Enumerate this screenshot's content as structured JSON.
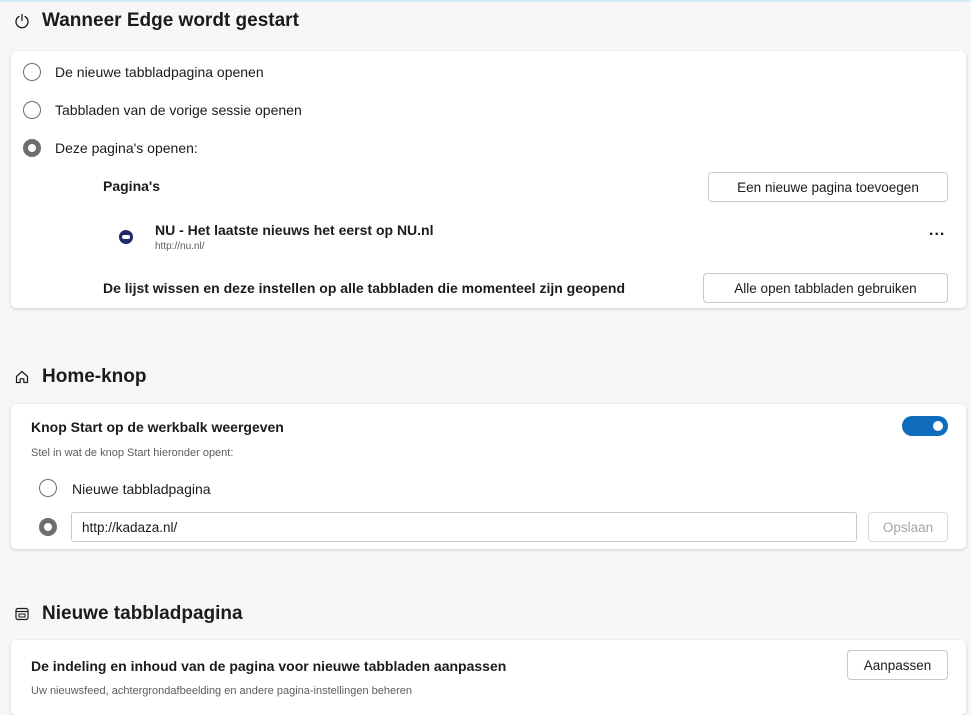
{
  "startup": {
    "title": "Wanneer Edge wordt gestart",
    "options": [
      {
        "label": "De nieuwe tabbladpagina openen",
        "selected": false
      },
      {
        "label": "Tabbladen van de vorige sessie openen",
        "selected": false
      },
      {
        "label": "Deze pagina's openen:",
        "selected": true
      }
    ],
    "pages_header": "Pagina's",
    "add_page_button": "Een nieuwe pagina toevoegen",
    "pages": [
      {
        "title": "NU - Het laatste nieuws het eerst op NU.nl",
        "url": "http://nu.nl/",
        "menu": "..."
      }
    ],
    "clear_text": "De lijst wissen en deze instellen op alle tabbladen die momenteel zijn geopend",
    "use_all_tabs_button": "Alle open tabbladen gebruiken"
  },
  "home": {
    "title": "Home-knop",
    "toggle_label": "Knop Start op de werkbalk weergeven",
    "toggle_on": true,
    "description": "Stel in wat de knop Start hieronder opent:",
    "options": [
      {
        "label": "Nieuwe tabbladpagina",
        "selected": false
      }
    ],
    "url_value": "http://kadaza.nl/",
    "save_button": "Opslaan"
  },
  "newtab": {
    "title": "Nieuwe tabbladpagina",
    "customize_label": "De indeling en inhoud van de pagina voor nieuwe tabbladen aanpassen",
    "customize_desc": "Uw nieuwsfeed, achtergrondafbeelding en andere pagina-instellingen beheren",
    "customize_button": "Aanpassen"
  },
  "colors": {
    "accent": "#0f6cbd",
    "radio": "#6e6e6e",
    "background": "#f7f7f7"
  },
  "icons": {
    "startup": "power-icon",
    "home": "home-icon",
    "newtab": "new-tab-icon",
    "favicon": "nu-favicon"
  }
}
